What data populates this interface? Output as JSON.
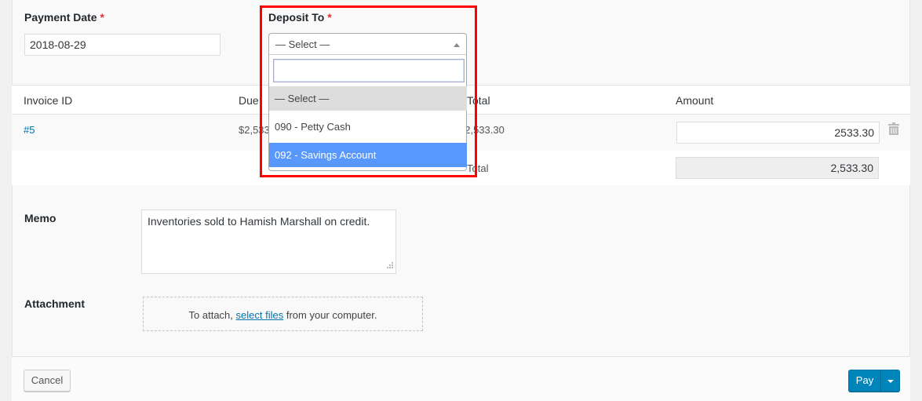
{
  "form": {
    "payment_date": {
      "label": "Payment Date",
      "required_mark": "*",
      "value": "2018-08-29"
    },
    "deposit_to": {
      "label": "Deposit To",
      "required_mark": "*",
      "selected": "— Select —",
      "search_value": "",
      "options": [
        {
          "label": "— Select —",
          "state": "selected"
        },
        {
          "label": "090 - Petty Cash",
          "state": "normal"
        },
        {
          "label": "092 - Savings Account",
          "state": "highlighted"
        }
      ]
    }
  },
  "table": {
    "headers": {
      "invoice_id": "Invoice ID",
      "due": "Due",
      "total": "Total",
      "amount": "Amount"
    },
    "rows": [
      {
        "invoice_id": "#5",
        "due": "$2,533.30",
        "total": "$2,533.30",
        "amount": "2533.30"
      }
    ],
    "footer": {
      "label": "Total",
      "amount": "2,533.30"
    }
  },
  "memo": {
    "label": "Memo",
    "value": "Inventories sold to Hamish Marshall on credit."
  },
  "attachment": {
    "label": "Attachment",
    "prefix": "To attach,",
    "link": "select files",
    "suffix": "from your computer."
  },
  "actions": {
    "cancel": "Cancel",
    "pay": "Pay"
  },
  "colors": {
    "primary": "#0085ba",
    "highlight": "#5897fb",
    "required": "#dc3232",
    "annotation": "#ff0000"
  }
}
